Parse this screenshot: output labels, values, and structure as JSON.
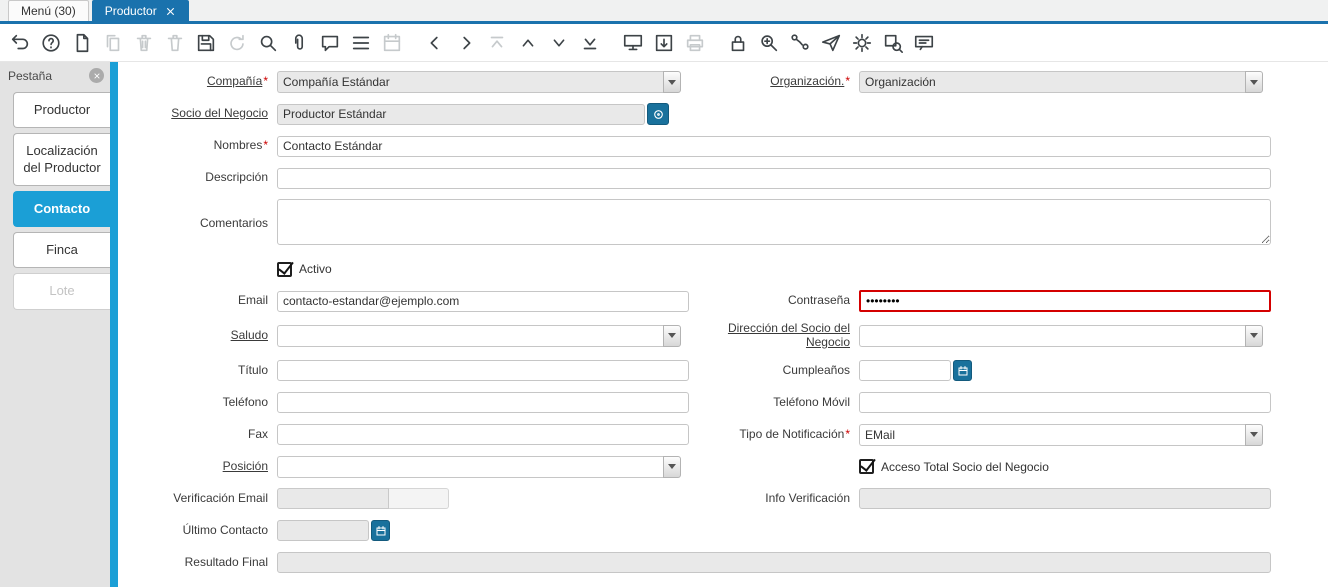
{
  "ui": {
    "required_marker": "*"
  },
  "theme": {
    "accent_blue": "#1a72ad",
    "tab_active_cyan": "#1b9fd6",
    "error_red": "#d40000",
    "button_teal": "#19719c",
    "readonly_gray": "#e9e9e9"
  },
  "window_tabs": {
    "menu": {
      "label": "Menú (30)"
    },
    "active": {
      "label": "Productor"
    }
  },
  "toolbar": {
    "icons": [
      "undo-icon",
      "help-icon",
      "new-record-icon",
      "copy-record-icon",
      "delete-record-icon",
      "delete-selection-icon",
      "save-icon",
      "refresh-icon",
      "find-icon",
      "attachment-icon",
      "chat-icon",
      "grid-toggle-icon",
      "calendar-icon",
      "parent-record-icon",
      "detail-record-icon",
      "first-record-icon",
      "previous-record-icon",
      "next-record-icon",
      "last-record-icon",
      "report-icon",
      "archive-icon",
      "print-icon",
      "lock-icon",
      "zoom-across-icon",
      "workflow-icon",
      "send-icon",
      "process-icon",
      "query-icon",
      "comments-panel-icon"
    ]
  },
  "sidebar": {
    "header": "Pestaña",
    "tabs": [
      {
        "label": "Productor",
        "state": "normal"
      },
      {
        "label": "Localización del Productor",
        "state": "normal"
      },
      {
        "label": "Contacto",
        "state": "active"
      },
      {
        "label": "Finca",
        "state": "normal"
      },
      {
        "label": "Lote",
        "state": "disabled"
      }
    ]
  },
  "form": {
    "compania": {
      "label": "Compañía",
      "value": "Compañía Estándar",
      "mandatory": true
    },
    "organizacion": {
      "label": "Organización.",
      "value": "Organización",
      "mandatory": true
    },
    "socio": {
      "label": "Socio del Negocio",
      "value": "Productor Estándar"
    },
    "nombres": {
      "label": "Nombres",
      "value": "Contacto Estándar",
      "mandatory": true
    },
    "descripcion": {
      "label": "Descripción",
      "value": ""
    },
    "comentarios": {
      "label": "Comentarios",
      "value": ""
    },
    "activo": {
      "label": "Activo",
      "checked": true
    },
    "email": {
      "label": "Email",
      "value": "contacto-estandar@ejemplo.com"
    },
    "contrasena": {
      "label": "Contraseña",
      "value": "••••••••"
    },
    "saludo": {
      "label": "Saludo",
      "value": ""
    },
    "direccion": {
      "label": "Dirección del Socio del Negocio",
      "value": ""
    },
    "titulo": {
      "label": "Título",
      "value": ""
    },
    "cumpleanos": {
      "label": "Cumpleaños",
      "value": ""
    },
    "telefono": {
      "label": "Teléfono",
      "value": ""
    },
    "telefono_movil": {
      "label": "Teléfono Móvil",
      "value": ""
    },
    "fax": {
      "label": "Fax",
      "value": ""
    },
    "tipo_notificacion": {
      "label": "Tipo de Notificación",
      "value": "EMail",
      "mandatory": true
    },
    "posicion": {
      "label": "Posición",
      "value": ""
    },
    "acceso_total": {
      "label": "Acceso Total Socio del Negocio",
      "checked": true
    },
    "verificacion_email": {
      "label": "Verificación Email",
      "value": ""
    },
    "info_verificacion": {
      "label": "Info Verificación",
      "value": ""
    },
    "ultimo_contacto": {
      "label": "Último Contacto",
      "value": ""
    },
    "resultado_final": {
      "label": "Resultado Final",
      "value": ""
    }
  }
}
